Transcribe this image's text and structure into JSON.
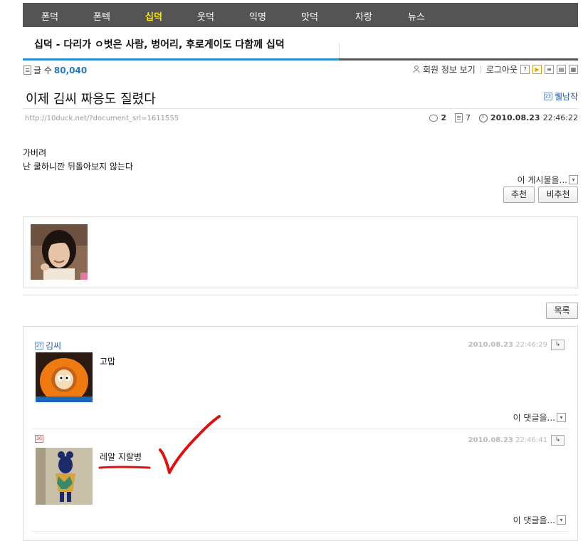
{
  "nav": {
    "items": [
      "폰덕",
      "폰텍",
      "십덕",
      "웃덕",
      "익명",
      "맛덕",
      "자랑",
      "뉴스"
    ],
    "active_index": 2,
    "active_color": "#ffe600"
  },
  "board": {
    "title": "십덕 - 다리가 ㅇ벗은 사람, 벙어리, 후로게이도 다함께 십덕"
  },
  "info": {
    "post_count_label": "글 수",
    "post_count": "80,040",
    "member_info": "회원 정보 보기",
    "logout": "로그아웃",
    "help": "?"
  },
  "post": {
    "title": "이제 김씨 짜응도 질렸다",
    "author_level": "23",
    "author": "퀠남작",
    "url": "http://10duck.net/?document_srl=1611555",
    "comments": "2",
    "views": "7",
    "date": "2010.08.23",
    "time": "22:46:22",
    "body_lines": [
      "가버려",
      "난 쿨하니깐 뒤돌아보지 않는다"
    ],
    "this_post_label": "이 게시물을...",
    "recommend_label": "추천",
    "unrecommend_label": "비추천"
  },
  "list_button": "목록",
  "comments": [
    {
      "level": "27",
      "author": "김씨",
      "date": "2010.08.23",
      "time": "22:46:29",
      "text": "고맙",
      "foot": "이 댓글을..."
    },
    {
      "level": "30",
      "author": "",
      "date": "2010.08.23",
      "time": "22:46:41",
      "text": "레알 지랄병",
      "foot": "이 댓글을..."
    }
  ],
  "annotation_color": "#e01010"
}
